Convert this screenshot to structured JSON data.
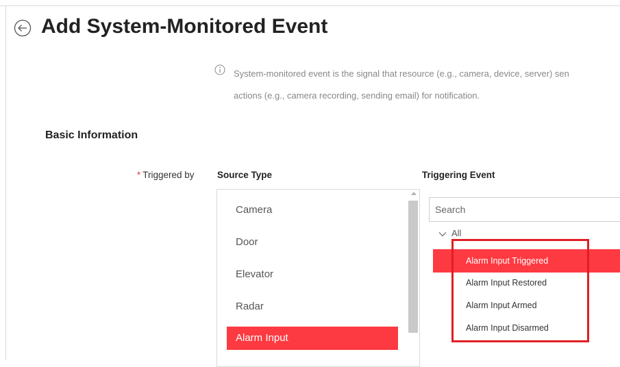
{
  "header": {
    "title": "Add System-Monitored Event"
  },
  "info": {
    "line1": "System-monitored event is the signal that resource (e.g., camera, device, server) sen",
    "line2": "actions (e.g., camera recording, sending email) for notification."
  },
  "basic": {
    "section_title": "Basic Information",
    "required_mark": "*",
    "triggered_by_label": "Triggered by",
    "source_type_header": "Source Type",
    "triggering_event_header": "Triggering Event"
  },
  "source_types": [
    {
      "label": "Camera"
    },
    {
      "label": "Door"
    },
    {
      "label": "Elevator"
    },
    {
      "label": "Radar"
    },
    {
      "label": "Alarm Input",
      "selected": true
    }
  ],
  "search": {
    "placeholder": "Search"
  },
  "tree": {
    "root_label": "All"
  },
  "events": [
    {
      "label": "Alarm Input Triggered",
      "selected": true
    },
    {
      "label": "Alarm Input Restored"
    },
    {
      "label": "Alarm Input Armed"
    },
    {
      "label": "Alarm Input Disarmed"
    }
  ],
  "colors": {
    "accent": "#fd3a41",
    "highlight_border": "#e11d24"
  },
  "icons": {
    "back": "back-arrow-circle-icon",
    "info": "info-circle-icon",
    "tree": "chevron-down-icon"
  }
}
